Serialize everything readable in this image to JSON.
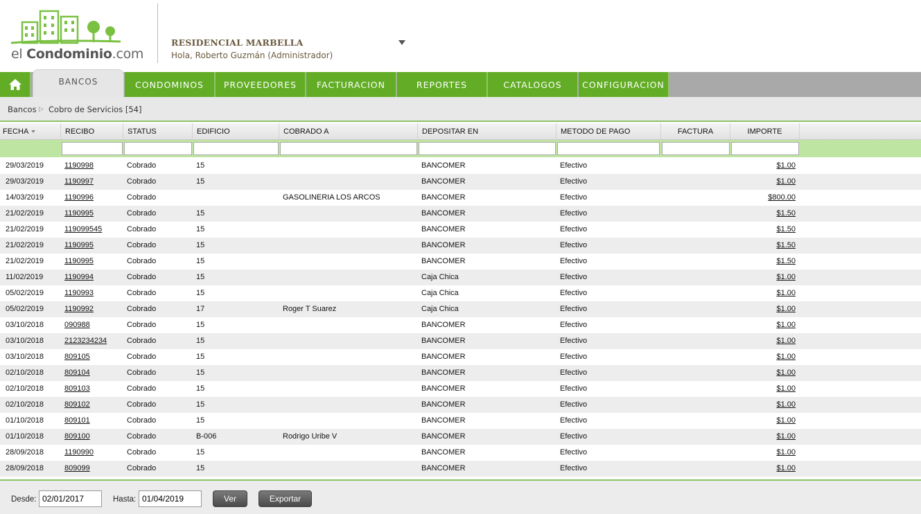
{
  "header": {
    "logo_text_light": "el ",
    "logo_text_bold": "Condominio",
    "logo_text_tail": ".com",
    "condo_name": "RESIDENCIAL MARBELLA",
    "greeting": "Hola, Roberto Guzmán (Administrador)"
  },
  "nav": {
    "home_icon": "home-icon",
    "tabs": [
      {
        "label": "BANCOS",
        "active": true
      },
      {
        "label": "CONDOMINOS"
      },
      {
        "label": "PROVEEDORES"
      },
      {
        "label": "FACTURACION"
      },
      {
        "label": "REPORTES"
      },
      {
        "label": "CATALOGOS"
      },
      {
        "label": "CONFIGURACION"
      }
    ]
  },
  "breadcrumb": {
    "root": "Bancos",
    "current": "Cobro de Servicios [54]"
  },
  "table": {
    "columns": [
      "FECHA",
      "RECIBO",
      "STATUS",
      "EDIFICIO",
      "COBRADO A",
      "DEPOSITAR EN",
      "METODO DE PAGO",
      "FACTURA",
      "IMPORTE"
    ],
    "rows": [
      [
        "29/03/2019",
        "1190998",
        "Cobrado",
        "15",
        "",
        "BANCOMER",
        "Efectivo",
        "",
        "$1.00"
      ],
      [
        "29/03/2019",
        "1190997",
        "Cobrado",
        "15",
        "",
        "BANCOMER",
        "Efectivo",
        "",
        "$1.00"
      ],
      [
        "14/03/2019",
        "1190996",
        "Cobrado",
        "",
        "GASOLINERIA LOS ARCOS",
        "BANCOMER",
        "Efectivo",
        "",
        "$800.00"
      ],
      [
        "21/02/2019",
        "1190995",
        "Cobrado",
        "15",
        "",
        "BANCOMER",
        "Efectivo",
        "",
        "$1.50"
      ],
      [
        "21/02/2019",
        "119099545",
        "Cobrado",
        "15",
        "",
        "BANCOMER",
        "Efectivo",
        "",
        "$1.50"
      ],
      [
        "21/02/2019",
        "1190995",
        "Cobrado",
        "15",
        "",
        "BANCOMER",
        "Efectivo",
        "",
        "$1.50"
      ],
      [
        "21/02/2019",
        "1190995",
        "Cobrado",
        "15",
        "",
        "BANCOMER",
        "Efectivo",
        "",
        "$1.50"
      ],
      [
        "11/02/2019",
        "1190994",
        "Cobrado",
        "15",
        "",
        "Caja Chica",
        "Efectivo",
        "",
        "$1.00"
      ],
      [
        "05/02/2019",
        "1190993",
        "Cobrado",
        "15",
        "",
        "Caja Chica",
        "Efectivo",
        "",
        "$1.00"
      ],
      [
        "05/02/2019",
        "1190992",
        "Cobrado",
        "17",
        "Roger T Suarez",
        "Caja Chica",
        "Efectivo",
        "",
        "$1.00"
      ],
      [
        "03/10/2018",
        "090988",
        "Cobrado",
        "15",
        "",
        "BANCOMER",
        "Efectivo",
        "",
        "$1.00"
      ],
      [
        "03/10/2018",
        "2123234234",
        "Cobrado",
        "15",
        "",
        "BANCOMER",
        "Efectivo",
        "",
        "$1.00"
      ],
      [
        "03/10/2018",
        "809105",
        "Cobrado",
        "15",
        "",
        "BANCOMER",
        "Efectivo",
        "",
        "$1.00"
      ],
      [
        "02/10/2018",
        "809104",
        "Cobrado",
        "15",
        "",
        "BANCOMER",
        "Efectivo",
        "",
        "$1.00"
      ],
      [
        "02/10/2018",
        "809103",
        "Cobrado",
        "15",
        "",
        "BANCOMER",
        "Efectivo",
        "",
        "$1.00"
      ],
      [
        "02/10/2018",
        "809102",
        "Cobrado",
        "15",
        "",
        "BANCOMER",
        "Efectivo",
        "",
        "$1.00"
      ],
      [
        "01/10/2018",
        "809101",
        "Cobrado",
        "15",
        "",
        "BANCOMER",
        "Efectivo",
        "",
        "$1.00"
      ],
      [
        "01/10/2018",
        "809100",
        "Cobrado",
        "B-006",
        "Rodrigo Uribe V",
        "BANCOMER",
        "Efectivo",
        "",
        "$1.00"
      ],
      [
        "28/09/2018",
        "1190990",
        "Cobrado",
        "15",
        "",
        "BANCOMER",
        "Efectivo",
        "",
        "$1.00"
      ],
      [
        "28/09/2018",
        "809099",
        "Cobrado",
        "15",
        "",
        "BANCOMER",
        "Efectivo",
        "",
        "$1.00"
      ]
    ]
  },
  "footer": {
    "desde_label": "Desde:",
    "desde_value": "02/01/2017",
    "hasta_label": "Hasta:",
    "hasta_value": "01/04/2019",
    "ver_label": "Ver",
    "exportar_label": "Exportar"
  },
  "colors": {
    "brand_green": "#62ad25",
    "filter_green": "#bfe5a2",
    "nav_gray": "#a9a9a9"
  }
}
